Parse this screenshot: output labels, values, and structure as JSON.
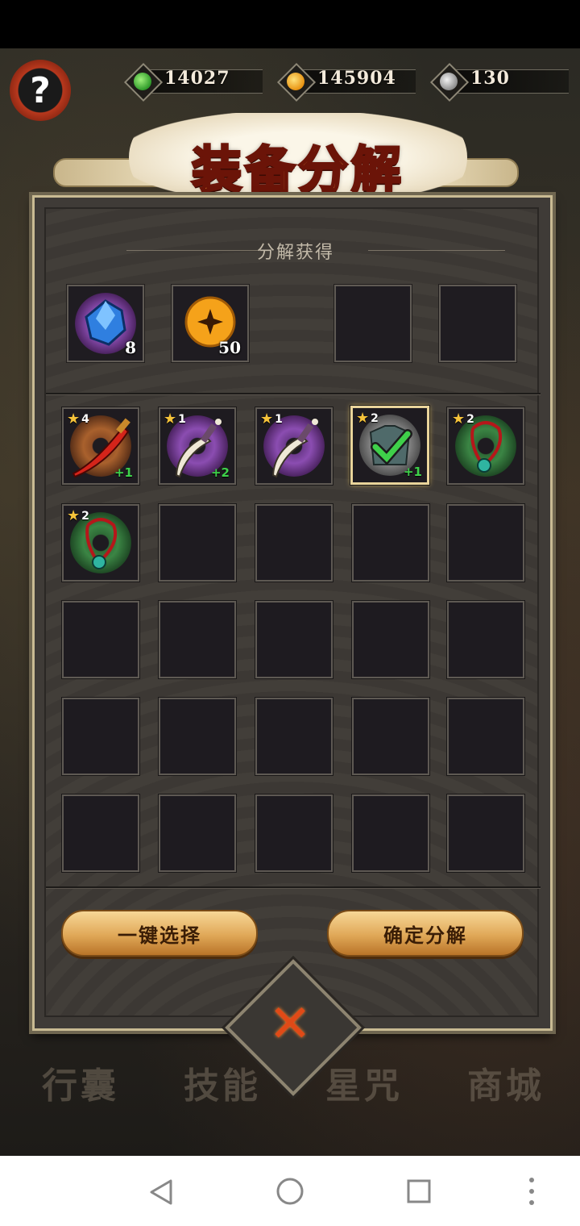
{
  "currencies": [
    {
      "icon": "green-jade-icon",
      "value": "14027",
      "color": "#3fb03c"
    },
    {
      "icon": "gold-coin-icon",
      "value": "145904",
      "color": "#f2a11c"
    },
    {
      "icon": "silver-coin-icon",
      "value": "130",
      "color": "#c9c9c9"
    }
  ],
  "help": {
    "label": "?"
  },
  "title": "装备分解",
  "reward_section": {
    "label": "分解获得",
    "slots": [
      {
        "icon": "blue-gem-icon",
        "count": "8"
      },
      {
        "icon": "gold-coin-icon",
        "count": "50"
      },
      {
        "icon": "",
        "count": ""
      },
      {
        "icon": "",
        "count": ""
      }
    ]
  },
  "items": [
    {
      "stars": "4",
      "plus": "+1",
      "icon": "red-blade-icon",
      "rarity": "orange",
      "selected": false
    },
    {
      "stars": "1",
      "plus": "+2",
      "icon": "curved-dagger-icon",
      "rarity": "purple",
      "selected": false
    },
    {
      "stars": "1",
      "plus": "",
      "icon": "curved-dagger-icon",
      "rarity": "purple",
      "selected": false
    },
    {
      "stars": "2",
      "plus": "+1",
      "icon": "armor-icon",
      "rarity": "grey",
      "selected": true
    },
    {
      "stars": "2",
      "plus": "",
      "icon": "jade-necklace-icon",
      "rarity": "green",
      "selected": false
    },
    {
      "stars": "2",
      "plus": "",
      "icon": "jade-necklace-icon",
      "rarity": "green",
      "selected": false
    }
  ],
  "buttons": {
    "auto_select": "一键选择",
    "confirm": "确定分解"
  },
  "bottom_tabs": [
    "行囊",
    "技能",
    "星咒",
    "商城"
  ]
}
